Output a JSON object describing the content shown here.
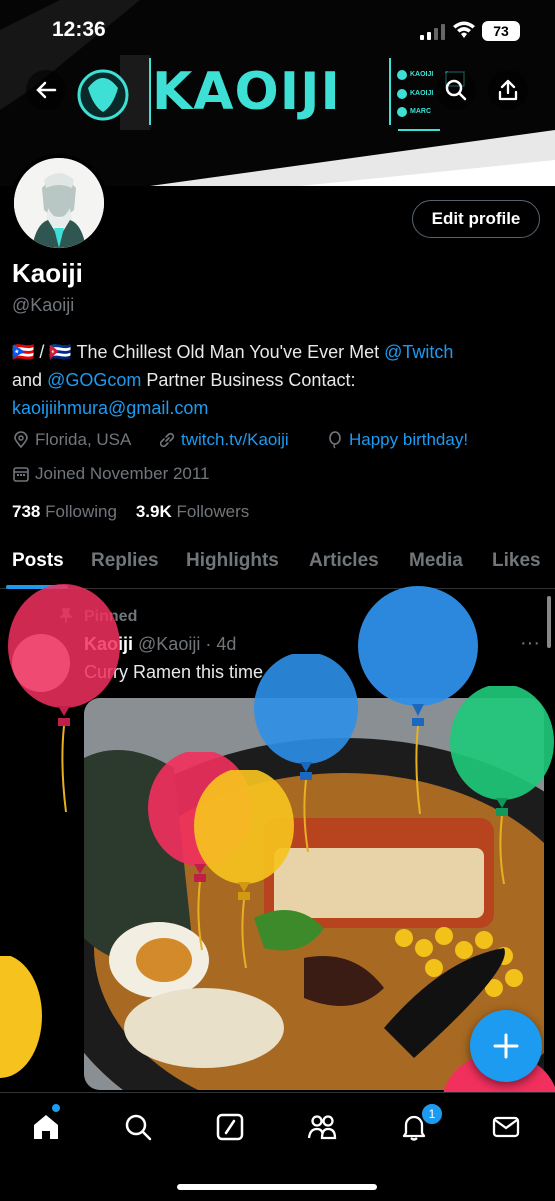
{
  "status_bar": {
    "time": "12:36",
    "battery": "73"
  },
  "banner": {
    "title": "KAOIJI",
    "socials": [
      "KAOIJI",
      "KAOIJI",
      "MARC"
    ],
    "colors": {
      "accent": "#3ee0d6"
    }
  },
  "profile": {
    "edit_button": "Edit profile",
    "name": "Kaoiji",
    "handle": "@Kaoiji",
    "bio": {
      "flags": "🇵🇷 / 🇨🇺",
      "text1": "The Chillest Old Man You've Ever Met",
      "mention1": "@Twitch",
      "text2": "and",
      "mention2": "@GOGcom",
      "text3": "Partner Business Contact:",
      "email": "kaoijiihmura@gmail.com"
    },
    "location": "Florida, USA",
    "website": "twitch.tv/Kaoiji",
    "birthday": "Happy birthday!",
    "joined": "Joined November 2011",
    "following_count": "738",
    "following_label": "Following",
    "followers_count": "3.9K",
    "followers_label": "Followers"
  },
  "tabs": [
    "Posts",
    "Replies",
    "Highlights",
    "Articles",
    "Media",
    "Likes"
  ],
  "post": {
    "pinned": "Pinned",
    "author": "Kaoiji",
    "handle_time": "@Kaoiji · 4d",
    "text": "Curry Ramen this time"
  },
  "nav": {
    "notification_count": "1"
  },
  "icons": [
    "back-arrow-icon",
    "search-icon",
    "share-icon",
    "location-icon",
    "link-icon",
    "balloon-icon",
    "calendar-icon",
    "pin-icon",
    "more-icon",
    "plus-icon",
    "home-icon",
    "explore-icon",
    "grok-icon",
    "communities-icon",
    "notifications-icon",
    "messages-icon"
  ]
}
